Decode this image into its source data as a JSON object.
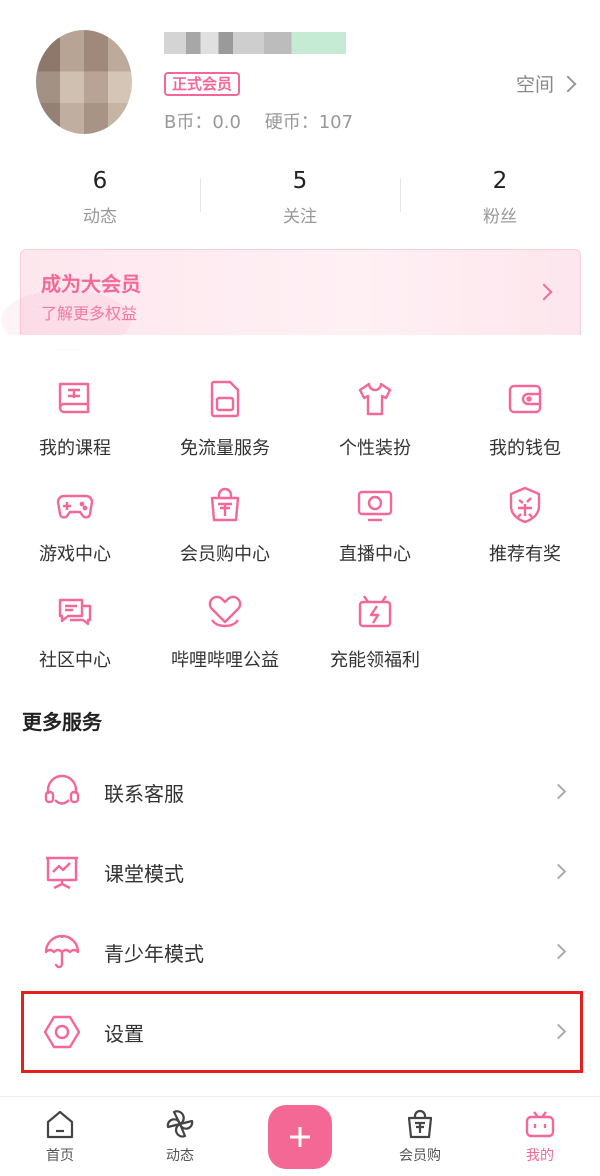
{
  "profile": {
    "badge": "正式会员",
    "bcoin": "B币：0.0",
    "coin": "硬币：107",
    "space": "空间"
  },
  "stats": [
    {
      "num": "6",
      "label": "动态"
    },
    {
      "num": "5",
      "label": "关注"
    },
    {
      "num": "2",
      "label": "粉丝"
    }
  ],
  "vip": {
    "title": "成为大会员",
    "subtitle": "了解更多权益"
  },
  "services": [
    {
      "label": "我的课程",
      "icon": "course-book-icon"
    },
    {
      "label": "免流量服务",
      "icon": "sim-card-icon"
    },
    {
      "label": "个性装扮",
      "icon": "tshirt-icon"
    },
    {
      "label": "我的钱包",
      "icon": "wallet-icon"
    },
    {
      "label": "游戏中心",
      "icon": "gamepad-icon"
    },
    {
      "label": "会员购中心",
      "icon": "shopping-bag-icon"
    },
    {
      "label": "直播中心",
      "icon": "tv-icon"
    },
    {
      "label": "推荐有奖",
      "icon": "award-badge-icon"
    },
    {
      "label": "社区中心",
      "icon": "chat-bubbles-icon"
    },
    {
      "label": "哔哩哔哩公益",
      "icon": "heart-icon"
    },
    {
      "label": "充能领福利",
      "icon": "gift-bolt-icon"
    }
  ],
  "more": {
    "title": "更多服务",
    "items": [
      {
        "label": "联系客服",
        "icon": "headset-icon"
      },
      {
        "label": "课堂模式",
        "icon": "classroom-board-icon"
      },
      {
        "label": "青少年模式",
        "icon": "umbrella-icon"
      },
      {
        "label": "设置",
        "icon": "settings-hexagon-icon"
      }
    ]
  },
  "nav": [
    {
      "label": "首页",
      "icon": "home-icon"
    },
    {
      "label": "动态",
      "icon": "pinwheel-icon"
    },
    {
      "label": "",
      "icon": "plus-icon"
    },
    {
      "label": "会员购",
      "icon": "shopping-bag-icon"
    },
    {
      "label": "我的",
      "icon": "bilibili-tv-icon"
    }
  ],
  "colors": {
    "accent": "#f46895",
    "highlight": "#e3201b"
  }
}
